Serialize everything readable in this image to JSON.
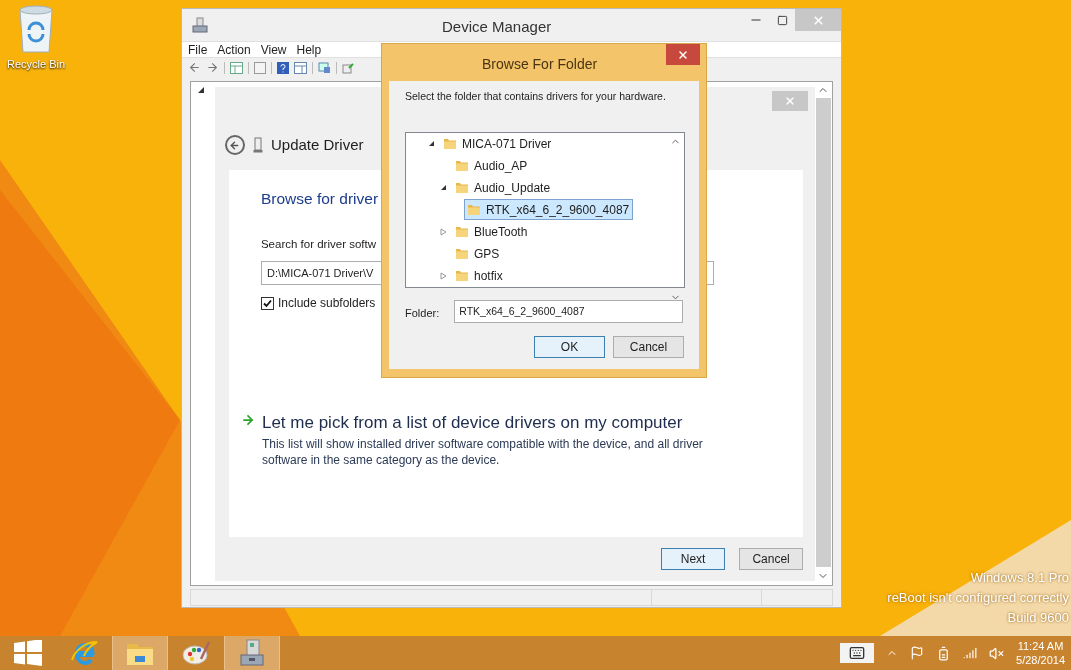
{
  "desktop": {
    "icons": [
      {
        "label": "Recycle Bin"
      }
    ],
    "watermark": [
      "Windows 8.1 Pro",
      "reBoot isn't configured correctly",
      "Build 9600"
    ]
  },
  "device_manager": {
    "title": "Device Manager",
    "menu": [
      "File",
      "Action",
      "View",
      "Help"
    ],
    "wizard": {
      "title": "Update Driver",
      "heading": "Browse for driver",
      "search_label": "Search for driver softw",
      "path_value": "D:\\MICA-071 Driver\\V",
      "include_subfolders": {
        "label": "Include subfolders",
        "checked": true
      },
      "pick_link": "Let me pick from a list of device drivers on my computer",
      "pick_description": "This list will show installed driver software compatible with the device, and all driver software in the same category as the device.",
      "buttons": [
        {
          "label": "Next",
          "default": true
        },
        {
          "label": "Cancel",
          "default": false
        }
      ]
    }
  },
  "browse_dialog": {
    "title": "Browse For Folder",
    "instruction": "Select the folder that contains drivers for your hardware.",
    "tree": [
      {
        "label": "MICA-071 Driver",
        "kind": "open",
        "selected": false,
        "children": [
          {
            "label": "Audio_AP",
            "kind": "leaf",
            "selected": false
          },
          {
            "label": "Audio_Update",
            "kind": "open",
            "selected": false,
            "children": [
              {
                "label": "RTK_x64_6_2_9600_4087",
                "kind": "leaf",
                "selected": true
              }
            ]
          },
          {
            "label": "BlueTooth",
            "kind": "closed",
            "selected": false
          },
          {
            "label": "GPS",
            "kind": "leaf",
            "selected": false
          },
          {
            "label": "hotfix",
            "kind": "closed",
            "selected": false
          }
        ]
      }
    ],
    "folder_label": "Folder:",
    "folder_value": "RTK_x64_6_2_9600_4087",
    "buttons": [
      {
        "label": "OK",
        "default": true
      },
      {
        "label": "Cancel",
        "default": false
      }
    ]
  },
  "taskbar": {
    "apps": [
      {
        "kind": "browser",
        "active": false
      },
      {
        "kind": "explorer",
        "active": true
      },
      {
        "kind": "paint",
        "active": false
      },
      {
        "kind": "device-manager",
        "active": true
      }
    ],
    "clock": {
      "time": "11:24 AM",
      "date": "5/28/2014"
    }
  }
}
